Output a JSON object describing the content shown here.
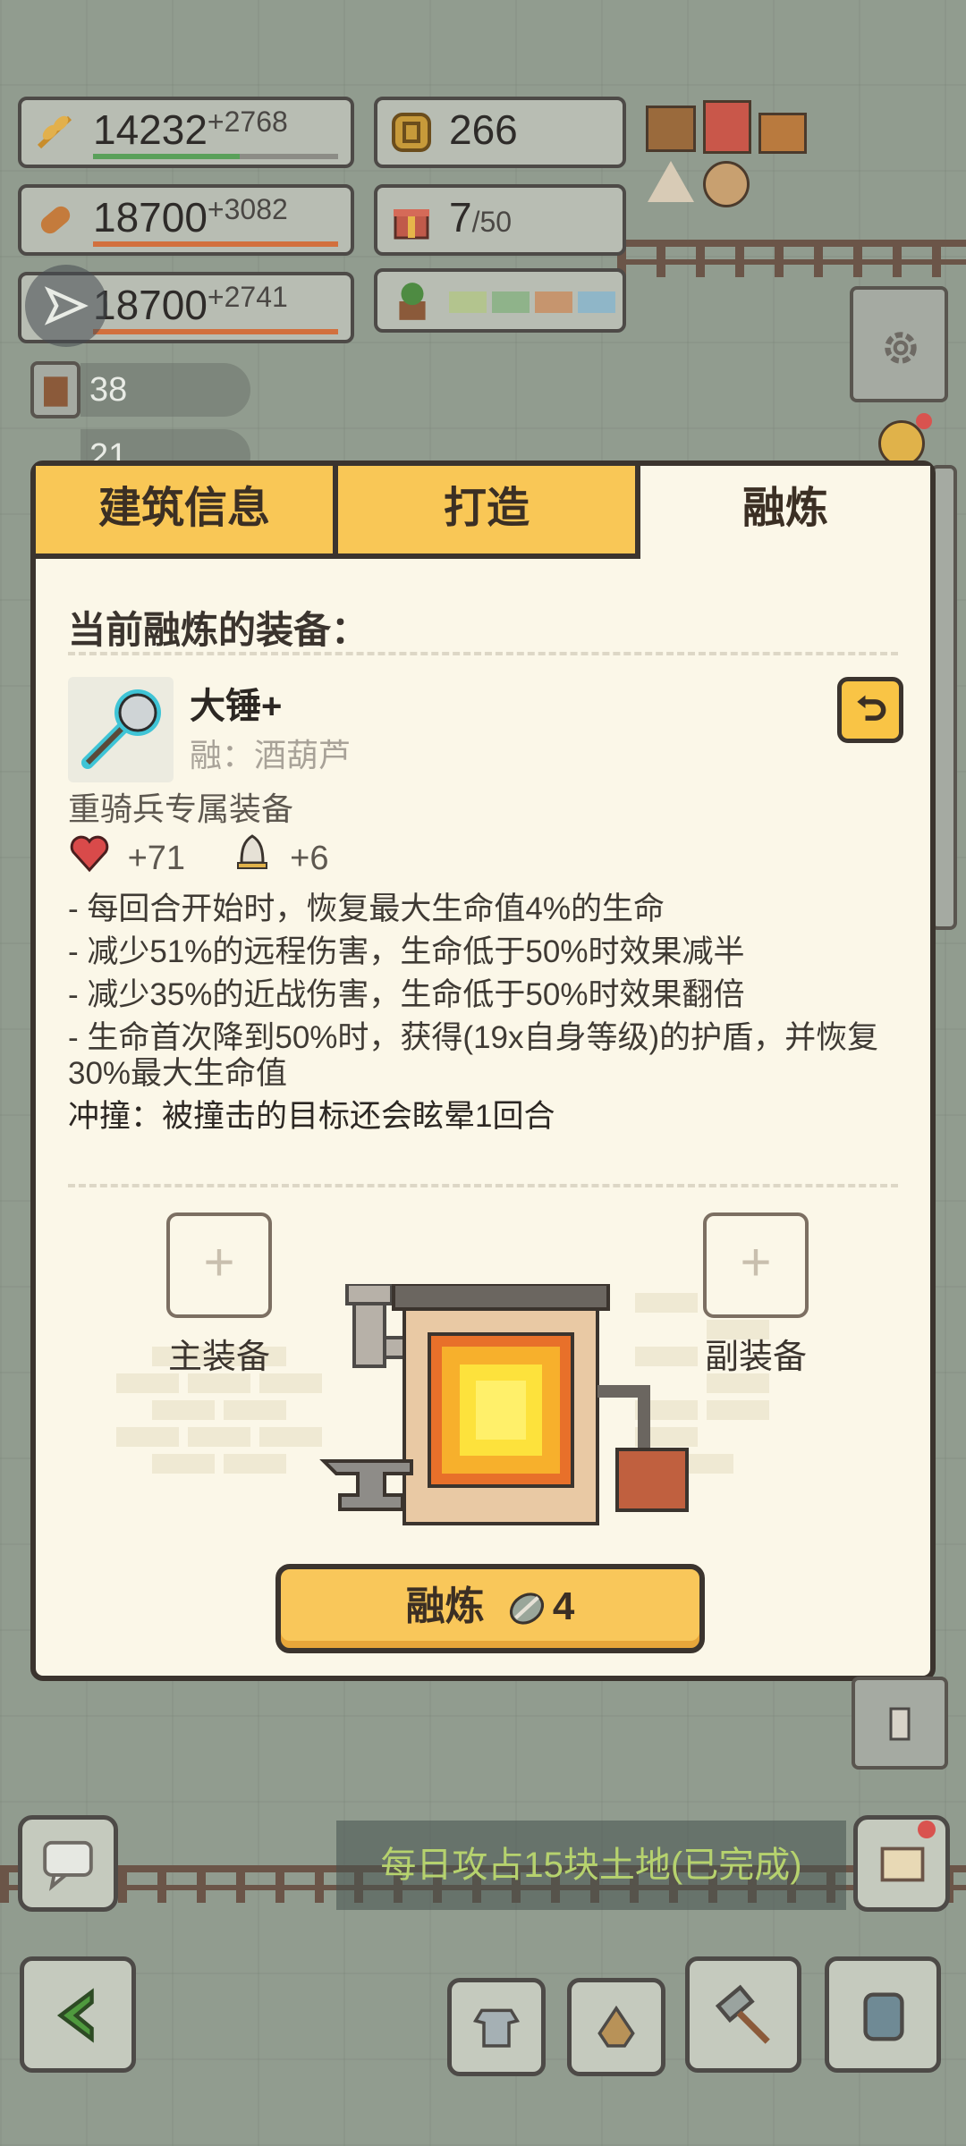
{
  "resources": [
    {
      "name": "wheat",
      "value": "14232",
      "plus": "+2768",
      "bar_color": "#5aa05a",
      "fill": 0.6
    },
    {
      "name": "coin",
      "value": "266"
    },
    {
      "name": "bread",
      "value": "18700",
      "plus": "+3082",
      "bar_color": "#d2703e",
      "fill": 1.0
    },
    {
      "name": "gift",
      "value": "7",
      "max": "/50"
    },
    {
      "name": "ore",
      "value": "18700",
      "plus": "+2741",
      "bar_color": "#d2703e",
      "fill": 1.0
    }
  ],
  "side_counts": {
    "first": "38",
    "second": "21"
  },
  "tabs": [
    {
      "label": "建筑信息",
      "active": false
    },
    {
      "label": "打造",
      "active": false
    },
    {
      "label": "融炼",
      "active": true
    }
  ],
  "panel": {
    "section_title": "当前融炼的装备：",
    "item_name": "大锤+",
    "item_sub": "融：酒葫芦",
    "exclusive": "重骑兵专属装备",
    "hp_bonus": "+71",
    "def_bonus": "+6",
    "effects": [
      "- 每回合开始时，恢复最大生命值4%的生命",
      "- 减少51%的远程伤害，生命低于50%时效果减半",
      "- 减少35%的近战伤害，生命低于50%时效果翻倍",
      "- 生命首次降到50%时，获得(19x自身等级)的护盾，并恢复30%最大生命值"
    ],
    "charge": "冲撞：被撞击的目标还会眩晕1回合",
    "main_slot_label": "主装备",
    "sub_slot_label": "副装备",
    "slot_plus": "+",
    "fuse_label": "融炼",
    "fuse_cost": "4"
  },
  "quest_text": "每日攻占15块土地(已完成)",
  "colors": {
    "accent": "#f9c756",
    "panel_bg": "#fbf7e8",
    "outline": "#3b342e"
  }
}
